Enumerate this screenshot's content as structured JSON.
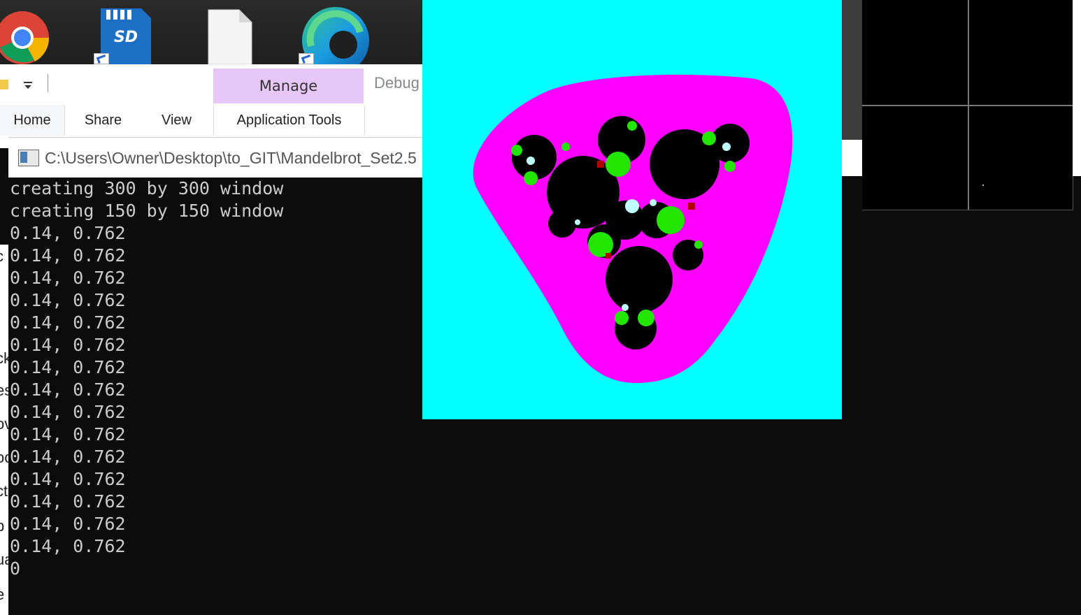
{
  "desktop": {
    "icons": [
      "chrome-icon",
      "sd-card-icon",
      "blank-file-icon",
      "edge-icon"
    ]
  },
  "explorer": {
    "manage_label": "Manage",
    "debug_label": "Debug",
    "tabs": {
      "home": "Home",
      "share": "Share",
      "view": "View",
      "application_tools": "Application Tools"
    }
  },
  "console": {
    "title": "C:\\Users\\Owner\\Desktop\\to_GIT\\Mandelbrot_Set2.5",
    "lines": [
      "creating 300 by 300 window",
      "creating 150 by 150 window",
      "0.14, 0.762",
      "0.14, 0.762",
      "0.14, 0.762",
      "0.14, 0.762",
      "0.14, 0.762",
      "0.14, 0.762",
      "0.14, 0.762",
      "0.14, 0.762",
      "0.14, 0.762",
      "0.14, 0.762",
      "0.14, 0.762",
      "0.14, 0.762",
      "0.14, 0.762",
      "0.14, 0.762",
      "0.14, 0.762",
      "0"
    ]
  },
  "left_edge_fragments": [
    "c",
    "ck",
    "es",
    "ov",
    "oc",
    "ct",
    "p",
    "ua",
    "e"
  ],
  "fractal": {
    "colors": {
      "background": "#00ffff",
      "outer_band": "#ff00ff",
      "set": "#000000",
      "green": "#22e600",
      "light": "#bfffff",
      "dark_red": "#b00000"
    }
  }
}
